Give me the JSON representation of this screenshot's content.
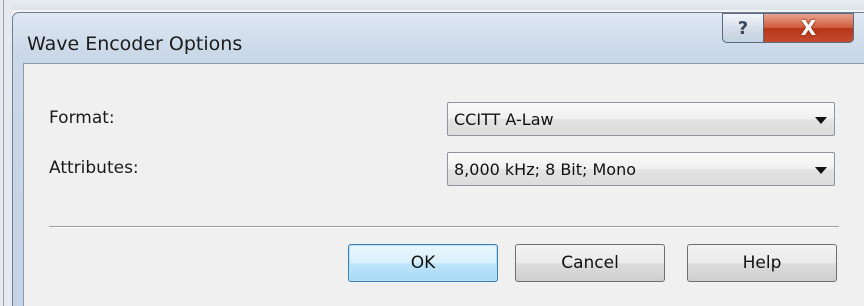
{
  "dialog": {
    "title": "Wave Encoder Options",
    "help_button": "?",
    "close_button": "X"
  },
  "format": {
    "label": "Format:",
    "value": "CCITT A-Law"
  },
  "attributes": {
    "label": "Attributes:",
    "value": "8,000 kHz; 8 Bit; Mono"
  },
  "buttons": {
    "ok": "OK",
    "cancel": "Cancel",
    "help": "Help"
  }
}
